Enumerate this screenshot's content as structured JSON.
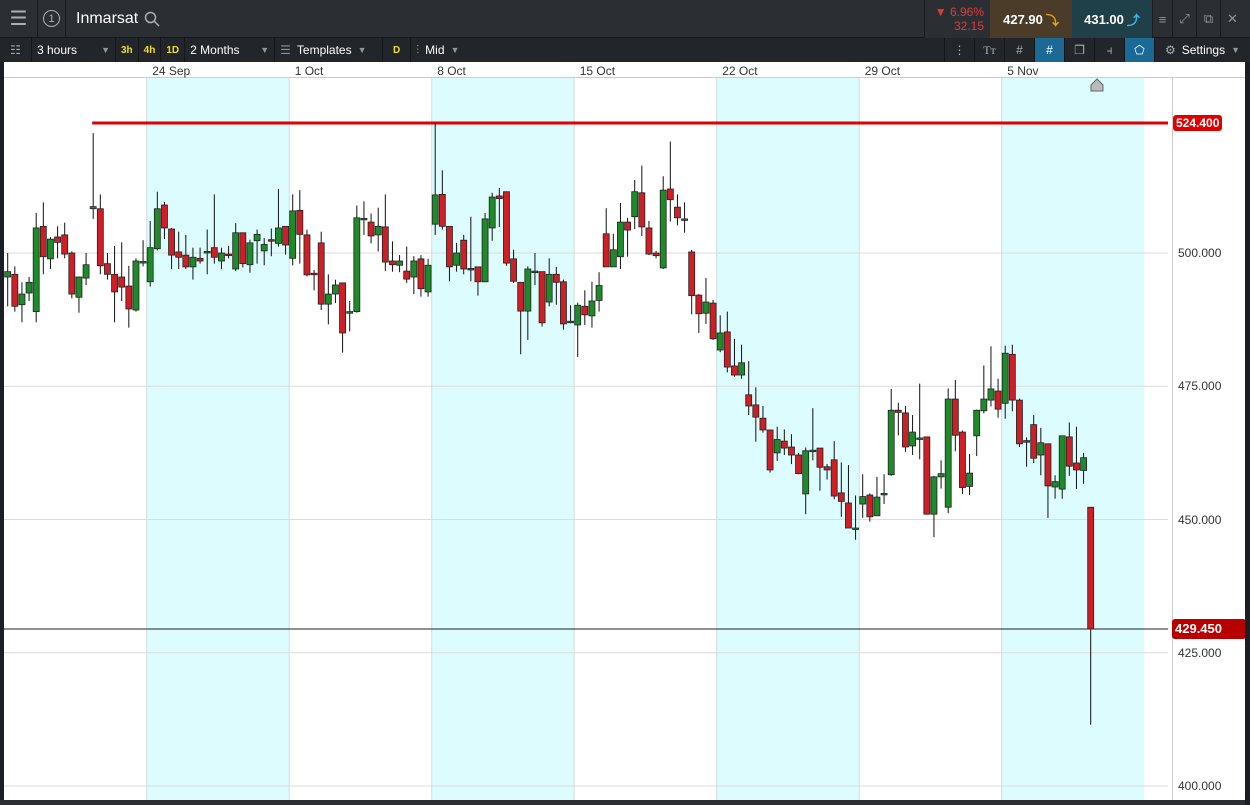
{
  "header": {
    "title": "Inmarsat",
    "change_pct": "6.96%",
    "change_abs": "32.15",
    "sell": "427.90",
    "buy": "431.00"
  },
  "toolbar": {
    "interval": "3 hours",
    "q1": "3h",
    "q2": "4h",
    "q3": "1D",
    "range": "2 Months",
    "templates": "Templates",
    "d": "D",
    "price_type": "Mid",
    "settings": "Settings",
    "text_tool": "Tт"
  },
  "colors": {
    "up": "#1f8a2a",
    "down": "#cc1f26",
    "band": "#dcfcfd",
    "hline": "#e00000",
    "price_tag": "#b80000"
  },
  "chart_data": {
    "type": "candlestick",
    "instrument": "Inmarsat",
    "ylim": [
      400,
      535
    ],
    "y_ticks": [
      "500.000",
      "475.000",
      "450.000",
      "425.000",
      "400.000"
    ],
    "y_tick_values": [
      500,
      475,
      450,
      425,
      400
    ],
    "x_labels": [
      {
        "label": "24 Sep",
        "index": 20
      },
      {
        "label": "1 Oct",
        "index": 40
      },
      {
        "label": "8 Oct",
        "index": 60
      },
      {
        "label": "15 Oct",
        "index": 80
      },
      {
        "label": "22 Oct",
        "index": 100
      },
      {
        "label": "29 Oct",
        "index": 120
      },
      {
        "label": "5 Nov",
        "index": 140
      }
    ],
    "shaded_weeks": [
      [
        20,
        40
      ],
      [
        60,
        80
      ],
      [
        100,
        120
      ],
      [
        140,
        160
      ]
    ],
    "horizontal_line": {
      "value": 524.4,
      "label": "524.400",
      "from_index": 12
    },
    "last_price": {
      "value": 429.45,
      "label": "429.450"
    },
    "ohlc": [
      [
        495.5,
        500,
        490,
        496.5
      ],
      [
        496,
        497.5,
        489,
        490
      ],
      [
        490.3,
        494.5,
        487,
        492.3
      ],
      [
        492.5,
        495.5,
        491,
        494.5
      ],
      [
        489,
        507.5,
        487,
        504.7
      ],
      [
        505,
        509.5,
        496,
        499.3
      ],
      [
        498.9,
        503,
        497,
        502.6
      ],
      [
        503,
        505,
        499,
        502
      ],
      [
        503.4,
        505.7,
        499,
        499.8
      ],
      [
        500,
        500.3,
        491.5,
        492.3
      ],
      [
        491.7,
        495.5,
        488.8,
        495.5
      ],
      [
        495.3,
        500,
        494,
        497.8
      ],
      [
        508.3,
        522.5,
        506.4,
        508.7
      ],
      [
        508.3,
        511,
        496,
        497.6
      ],
      [
        498,
        500,
        495,
        496
      ],
      [
        496,
        501.3,
        487,
        492.7
      ],
      [
        495.5,
        502,
        491,
        493.6
      ],
      [
        493.8,
        497.6,
        486,
        489.5
      ],
      [
        489.3,
        499,
        489,
        498.5
      ],
      [
        498.2,
        502.4,
        497.5,
        498.4
      ],
      [
        494.6,
        506,
        493.7,
        501
      ],
      [
        500.8,
        511.5,
        500.5,
        508.3
      ],
      [
        509,
        509.6,
        502.6,
        504.7
      ],
      [
        504.5,
        504.7,
        497,
        499.6
      ],
      [
        500.2,
        504,
        497,
        499.2
      ],
      [
        499.6,
        503.4,
        497,
        497.4
      ],
      [
        497.4,
        501,
        495,
        499.2
      ],
      [
        499,
        501,
        498,
        498.5
      ],
      [
        500,
        504.4,
        496,
        500.3
      ],
      [
        501,
        511,
        498,
        499.2
      ],
      [
        498.5,
        501,
        497,
        500
      ],
      [
        499.8,
        501.3,
        499,
        499.7
      ],
      [
        497,
        505.6,
        496.6,
        503.8
      ],
      [
        503.8,
        503.8,
        497.3,
        498
      ],
      [
        497.8,
        502.5,
        496.3,
        501.9
      ],
      [
        502.3,
        504.4,
        498,
        503.5
      ],
      [
        500.4,
        502.8,
        497.7,
        501.6
      ],
      [
        502.5,
        504.6,
        499.4,
        502.3
      ],
      [
        501.8,
        512,
        501.2,
        504.7
      ],
      [
        505,
        505,
        499.7,
        501.5
      ],
      [
        499,
        511,
        497.7,
        507.9
      ],
      [
        508,
        511.8,
        498,
        503.5
      ],
      [
        503.4,
        504.4,
        495.6,
        495.9
      ],
      [
        496.2,
        496.8,
        493,
        496
      ],
      [
        501.9,
        504,
        489.3,
        490.4
      ],
      [
        490.4,
        496,
        486.6,
        492.3
      ],
      [
        492.3,
        495,
        490.6,
        494
      ],
      [
        494.4,
        494.4,
        481.3,
        485
      ],
      [
        488.7,
        491,
        485.3,
        489
      ],
      [
        489,
        508.9,
        488.8,
        506.6
      ],
      [
        506.4,
        509.7,
        503.4,
        506.5
      ],
      [
        505.8,
        507.4,
        501.8,
        503.2
      ],
      [
        503.4,
        508.5,
        500.3,
        505
      ],
      [
        504.9,
        511,
        496.6,
        498.3
      ],
      [
        498.5,
        502.2,
        496.5,
        497.8
      ],
      [
        497.7,
        499.6,
        496.4,
        498.5
      ],
      [
        496.6,
        501.2,
        494.4,
        495.1
      ],
      [
        495.5,
        499.4,
        492.3,
        498.5
      ],
      [
        498.9,
        499.6,
        491.8,
        493.3
      ],
      [
        492.7,
        498.9,
        491.8,
        497.7
      ],
      [
        505.4,
        524.4,
        503.4,
        510.9
      ],
      [
        511,
        515.5,
        504.4,
        505
      ],
      [
        505,
        505,
        494.7,
        497.4
      ],
      [
        497.7,
        501.9,
        496.5,
        500
      ],
      [
        502.4,
        503.4,
        496,
        497
      ],
      [
        497.1,
        506.8,
        494.7,
        497
      ],
      [
        497.4,
        497.4,
        492,
        494.6
      ],
      [
        494.6,
        507.5,
        494.6,
        506.4
      ],
      [
        504.7,
        511.3,
        502.3,
        510.5
      ],
      [
        510.7,
        512.2,
        504.9,
        510.2
      ],
      [
        511.5,
        511.5,
        497.6,
        498.1
      ],
      [
        498.9,
        500.6,
        494.4,
        494.7
      ],
      [
        494.5,
        494.5,
        481,
        489.1
      ],
      [
        489.1,
        497.5,
        483.7,
        497
      ],
      [
        496.6,
        500,
        494,
        496.6
      ],
      [
        496.5,
        496.5,
        486.2,
        486.9
      ],
      [
        490.8,
        499,
        490,
        496
      ],
      [
        496,
        497.4,
        490.3,
        494.5
      ],
      [
        494.6,
        495,
        485.6,
        486.7
      ],
      [
        487,
        490.2,
        486.8,
        487.2
      ],
      [
        486.5,
        490.7,
        480.5,
        490.2
      ],
      [
        490,
        493,
        486.5,
        488.4
      ],
      [
        488.2,
        494.6,
        486,
        491
      ],
      [
        491.1,
        496.4,
        489,
        493.9
      ],
      [
        503.6,
        508.4,
        497.4,
        497.4
      ],
      [
        497.4,
        503.6,
        497.4,
        500.6
      ],
      [
        499.3,
        509.4,
        497,
        505.8
      ],
      [
        505.8,
        506.6,
        499.3,
        504.3
      ],
      [
        506.8,
        513.7,
        504.5,
        511.5
      ],
      [
        511.3,
        516.4,
        503.2,
        504.9
      ],
      [
        504.7,
        506,
        499.6,
        499.8
      ],
      [
        500,
        500.4,
        499,
        499.5
      ],
      [
        497.2,
        514.4,
        497,
        511.8
      ],
      [
        512,
        520.9,
        505.9,
        510
      ],
      [
        508.6,
        511,
        505.2,
        506.6
      ],
      [
        506.4,
        509.5,
        503.8,
        506.4
      ],
      [
        500.2,
        500.6,
        488.5,
        492
      ],
      [
        492.1,
        492.3,
        485,
        488.6
      ],
      [
        488.7,
        495.3,
        486.7,
        490.8
      ],
      [
        490.6,
        491.2,
        483.7,
        483.9
      ],
      [
        481.8,
        488.3,
        481.4,
        485
      ],
      [
        485.2,
        489,
        477.6,
        478.6
      ],
      [
        478.8,
        483.9,
        476.8,
        477.1
      ],
      [
        477.1,
        482.8,
        476.4,
        479.4
      ],
      [
        473.4,
        479.7,
        469.6,
        471.3
      ],
      [
        471.5,
        474.8,
        464.6,
        469.2
      ],
      [
        469,
        471.3,
        466.3,
        466.8
      ],
      [
        466.8,
        466.8,
        458.8,
        459.3
      ],
      [
        462.5,
        467.4,
        461,
        465
      ],
      [
        464.7,
        466.9,
        462.1,
        463.4
      ],
      [
        463.6,
        466,
        460.4,
        462.1
      ],
      [
        462.1,
        462.5,
        458.5,
        458.6
      ],
      [
        454.8,
        463.5,
        451,
        462.9
      ],
      [
        463,
        470.9,
        461.1,
        463
      ],
      [
        463.4,
        463.4,
        455.4,
        459.8
      ],
      [
        459.9,
        460.4,
        457.5,
        459.3
      ],
      [
        461.2,
        464.7,
        453.8,
        454.4
      ],
      [
        455,
        460.7,
        450.5,
        453.4
      ],
      [
        453.1,
        460.2,
        448.4,
        448.4
      ],
      [
        448.4,
        454.5,
        446.2,
        448.4
      ],
      [
        452.9,
        458.5,
        450.3,
        454.3
      ],
      [
        454.6,
        454.9,
        449.6,
        450.5
      ],
      [
        450.7,
        458,
        450.7,
        454.2
      ],
      [
        454.7,
        458.5,
        452.9,
        454.9
      ],
      [
        458.4,
        474.5,
        458.2,
        470.5
      ],
      [
        470.5,
        471.9,
        465.8,
        470.1
      ],
      [
        470,
        471.3,
        462.7,
        463.6
      ],
      [
        463.8,
        469.6,
        462.1,
        466.4
      ],
      [
        465.3,
        475.5,
        461.3,
        465.3
      ],
      [
        465.5,
        465.5,
        451,
        451
      ],
      [
        451,
        458.2,
        446.7,
        458
      ],
      [
        458,
        461.1,
        455.8,
        458.6
      ],
      [
        452.3,
        474.6,
        451.2,
        472.6
      ],
      [
        472.6,
        476.2,
        462.8,
        465.8
      ],
      [
        466.4,
        466.7,
        454.8,
        456
      ],
      [
        456.2,
        462.3,
        454.6,
        458.7
      ],
      [
        465.7,
        470.6,
        461.9,
        470.5
      ],
      [
        470.4,
        478.9,
        469.9,
        472.6
      ],
      [
        472.4,
        482.5,
        471.2,
        474.5
      ],
      [
        474.1,
        476.4,
        469.1,
        470.7
      ],
      [
        471.8,
        482.6,
        468.9,
        481.2
      ],
      [
        481,
        482.8,
        470.3,
        472.4
      ],
      [
        472.4,
        472.7,
        463.6,
        464.2
      ],
      [
        464.8,
        465.4,
        459.9,
        464.5
      ],
      [
        467.8,
        469.6,
        460.6,
        461.5
      ],
      [
        462.1,
        467.2,
        458.3,
        464.4
      ],
      [
        464.2,
        464.3,
        450.3,
        456.3
      ],
      [
        456.1,
        458.3,
        453.9,
        457.1
      ],
      [
        455.7,
        465.7,
        453.9,
        465.7
      ],
      [
        465.5,
        468.2,
        458.2,
        460
      ],
      [
        460.6,
        467.4,
        455.7,
        459.3
      ],
      [
        459.2,
        462.5,
        456.7,
        461.6
      ],
      [
        452.3,
        452.3,
        411.5,
        429.45
      ]
    ]
  }
}
